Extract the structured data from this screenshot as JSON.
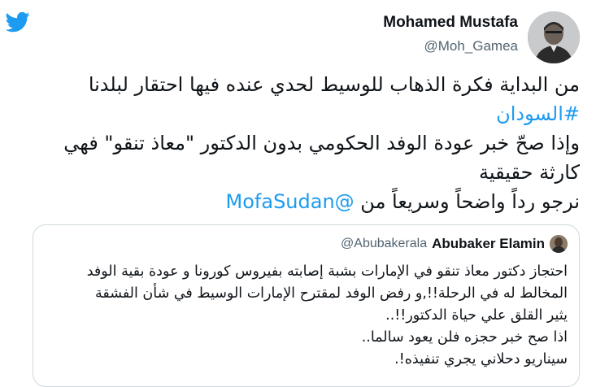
{
  "tweet": {
    "author_name": "Mohamed Mustafa",
    "author_handle": "@Moh_Gamea",
    "lines": {
      "l1": "من البداية فكرة الذهاب للوسيط لحدي عنده فيها احتقار لبلدنا",
      "hashtag": "#السودان",
      "l3": "وإذا صحّ خبر عودة الوفد الحكومي بدون الدكتور \"معاذ تنقو\" فهي",
      "l4": "كارثة حقيقية",
      "l5_text": "نرجو رداً واضحاً وسريعاً من ",
      "l5_mention": "@MofaSudan"
    }
  },
  "quote": {
    "author_name": "Abubaker Elamin",
    "author_handle": "@Abubakerala",
    "lines": {
      "l1": "احتجاز دكتور معاذ تنقو في الإمارات بشبة إصابته بفيروس كورونا و عودة بقية الوفد",
      "l2": "المخالط له في الرحلة!!,و رفض الوفد لمقترح الإمارات الوسيط في شأن الفشقة",
      "l3": "يثير القلق علي حياة الدكتور!!..",
      "l4": "اذا صح خبر حجزه فلن يعود سالما..",
      "l5": "سيناريو دحلاني يجري تنفيذه!."
    }
  },
  "colors": {
    "brand": "#1d9bf0",
    "text": "#0f1419",
    "secondary": "#536471",
    "border": "#cfd9de"
  },
  "icons": {
    "logo": "twitter-bird-icon"
  }
}
